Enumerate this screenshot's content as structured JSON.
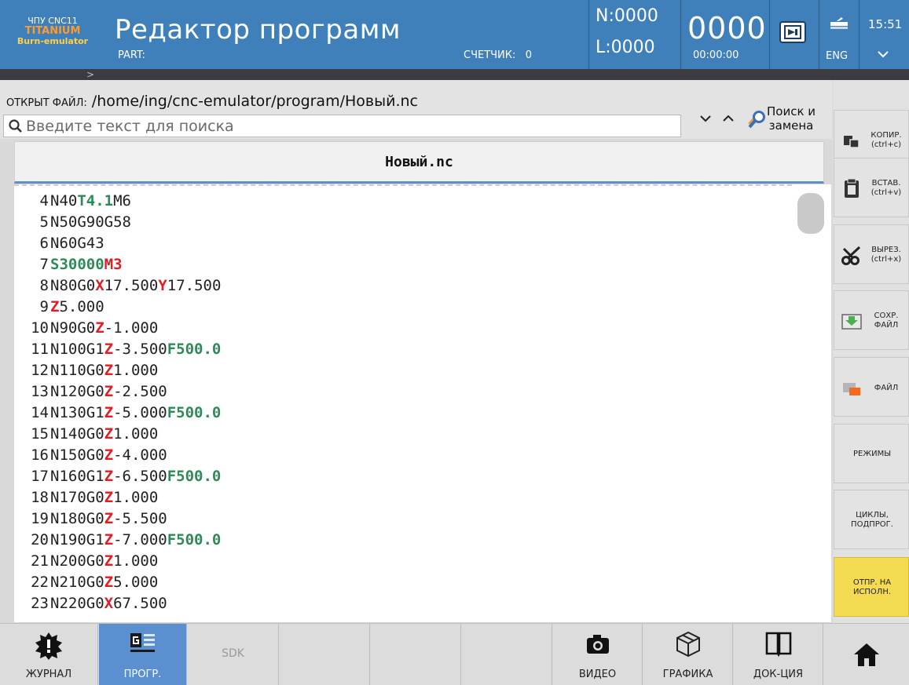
{
  "header": {
    "brand_line1": "ЧПУ CNC11",
    "brand_line2": "TITANIUM",
    "brand_line3": "Burn-emulator",
    "title": "Редактор программ",
    "part_label": "PART:",
    "counter_label": "СЧЕТЧИК:",
    "counter_value": "0",
    "n_value": "N:0000",
    "l_value": "L:0000",
    "big_counter": "0000",
    "timer": "00:00:00",
    "language": "ENG",
    "clock": "15:51",
    "breadcrumb_marker": ">"
  },
  "file": {
    "open_label": "ОТКРЫТ ФАЙЛ:",
    "path": "/home/ing/cnc-emulator/program/Новый.nc",
    "search_placeholder": "Введите текст для поиска",
    "search_value": "",
    "replace_label_1": "Поиск и",
    "replace_label_2": "замена"
  },
  "editor": {
    "tab_title": "Новый.nc",
    "lines": [
      {
        "num": "4",
        "tokens": [
          {
            "t": "N40",
            "c": "n"
          },
          {
            "t": "T4.1",
            "c": "g"
          },
          {
            "t": "M6",
            "c": "n"
          }
        ]
      },
      {
        "num": "5",
        "tokens": [
          {
            "t": "N50G90G58",
            "c": "n"
          }
        ]
      },
      {
        "num": "6",
        "tokens": [
          {
            "t": "N60G43",
            "c": "n"
          }
        ]
      },
      {
        "num": "7",
        "tokens": [
          {
            "t": "S30000",
            "c": "g"
          },
          {
            "t": "M3",
            "c": "r"
          }
        ]
      },
      {
        "num": "8",
        "tokens": [
          {
            "t": "N80G0",
            "c": "n"
          },
          {
            "t": "X",
            "c": "r"
          },
          {
            "t": "17.500",
            "c": "n"
          },
          {
            "t": "Y",
            "c": "r"
          },
          {
            "t": "17.500",
            "c": "n"
          }
        ]
      },
      {
        "num": "9",
        "tokens": [
          {
            "t": "Z",
            "c": "r"
          },
          {
            "t": "5.000",
            "c": "n"
          }
        ]
      },
      {
        "num": "10",
        "tokens": [
          {
            "t": "N90G0",
            "c": "n"
          },
          {
            "t": "Z",
            "c": "r"
          },
          {
            "t": "-1.000",
            "c": "n"
          }
        ]
      },
      {
        "num": "11",
        "tokens": [
          {
            "t": "N100G1",
            "c": "n"
          },
          {
            "t": "Z",
            "c": "r"
          },
          {
            "t": "-3.500",
            "c": "n"
          },
          {
            "t": "F500.0",
            "c": "g"
          }
        ]
      },
      {
        "num": "12",
        "tokens": [
          {
            "t": "N110G0",
            "c": "n"
          },
          {
            "t": "Z",
            "c": "r"
          },
          {
            "t": "1.000",
            "c": "n"
          }
        ]
      },
      {
        "num": "13",
        "tokens": [
          {
            "t": "N120G0",
            "c": "n"
          },
          {
            "t": "Z",
            "c": "r"
          },
          {
            "t": "-2.500",
            "c": "n"
          }
        ]
      },
      {
        "num": "14",
        "tokens": [
          {
            "t": "N130G1",
            "c": "n"
          },
          {
            "t": "Z",
            "c": "r"
          },
          {
            "t": "-5.000",
            "c": "n"
          },
          {
            "t": "F500.0",
            "c": "g"
          }
        ]
      },
      {
        "num": "15",
        "tokens": [
          {
            "t": "N140G0",
            "c": "n"
          },
          {
            "t": "Z",
            "c": "r"
          },
          {
            "t": "1.000",
            "c": "n"
          }
        ]
      },
      {
        "num": "16",
        "tokens": [
          {
            "t": "N150G0",
            "c": "n"
          },
          {
            "t": "Z",
            "c": "r"
          },
          {
            "t": "-4.000",
            "c": "n"
          }
        ]
      },
      {
        "num": "17",
        "tokens": [
          {
            "t": "N160G1",
            "c": "n"
          },
          {
            "t": "Z",
            "c": "r"
          },
          {
            "t": "-6.500",
            "c": "n"
          },
          {
            "t": "F500.0",
            "c": "g"
          }
        ]
      },
      {
        "num": "18",
        "tokens": [
          {
            "t": "N170G0",
            "c": "n"
          },
          {
            "t": "Z",
            "c": "r"
          },
          {
            "t": "1.000",
            "c": "n"
          }
        ]
      },
      {
        "num": "19",
        "tokens": [
          {
            "t": "N180G0",
            "c": "n"
          },
          {
            "t": "Z",
            "c": "r"
          },
          {
            "t": "-5.500",
            "c": "n"
          }
        ]
      },
      {
        "num": "20",
        "tokens": [
          {
            "t": "N190G1",
            "c": "n"
          },
          {
            "t": "Z",
            "c": "r"
          },
          {
            "t": "-7.000",
            "c": "n"
          },
          {
            "t": "F500.0",
            "c": "g"
          }
        ]
      },
      {
        "num": "21",
        "tokens": [
          {
            "t": "N200G0",
            "c": "n"
          },
          {
            "t": "Z",
            "c": "r"
          },
          {
            "t": "1.000",
            "c": "n"
          }
        ]
      },
      {
        "num": "22",
        "tokens": [
          {
            "t": "N210G0",
            "c": "n"
          },
          {
            "t": "Z",
            "c": "r"
          },
          {
            "t": "5.000",
            "c": "n"
          }
        ]
      },
      {
        "num": "23",
        "tokens": [
          {
            "t": "N220G0",
            "c": "n"
          },
          {
            "t": "X",
            "c": "r"
          },
          {
            "t": "67.500",
            "c": "n"
          }
        ]
      }
    ]
  },
  "sidebar": {
    "copy_1": "КОПИР.",
    "copy_2": "(ctrl+c)",
    "paste_1": "ВСТАВ.",
    "paste_2": "(ctrl+v)",
    "cut_1": "ВЫРЕЗ.",
    "cut_2": "(ctrl+x)",
    "save_1": "СОХР.",
    "save_2": "ФАЙЛ",
    "file": "ФАЙЛ",
    "modes": "РЕЖИМЫ",
    "cycles_1": "ЦИКЛЫ,",
    "cycles_2": "ПОДПРОГ.",
    "send_1": "ОТПР. НА",
    "send_2": "ИСПОЛН."
  },
  "bottom": {
    "journal": "ЖУРНАЛ",
    "program": "ПРОГР.",
    "sdk": "SDK",
    "video": "ВИДЕО",
    "graphics": "ГРАФИКА",
    "docs": "ДОК-ЦИЯ"
  },
  "colors": {
    "header_bg": "#3f7fba",
    "active_tab": "#5b8fcf",
    "send_button": "#f5db52",
    "code_green": "#2e8b57",
    "code_red": "#e31b23"
  },
  "icons": {
    "search": "magnifier-icon",
    "down": "chevron-down-icon",
    "up": "chevron-up-icon",
    "replace": "search-replace-icon",
    "home": "home-icon",
    "journal": "alert-gear-icon",
    "video": "camera-icon",
    "graphics": "cube-icon",
    "docs": "book-icon"
  }
}
